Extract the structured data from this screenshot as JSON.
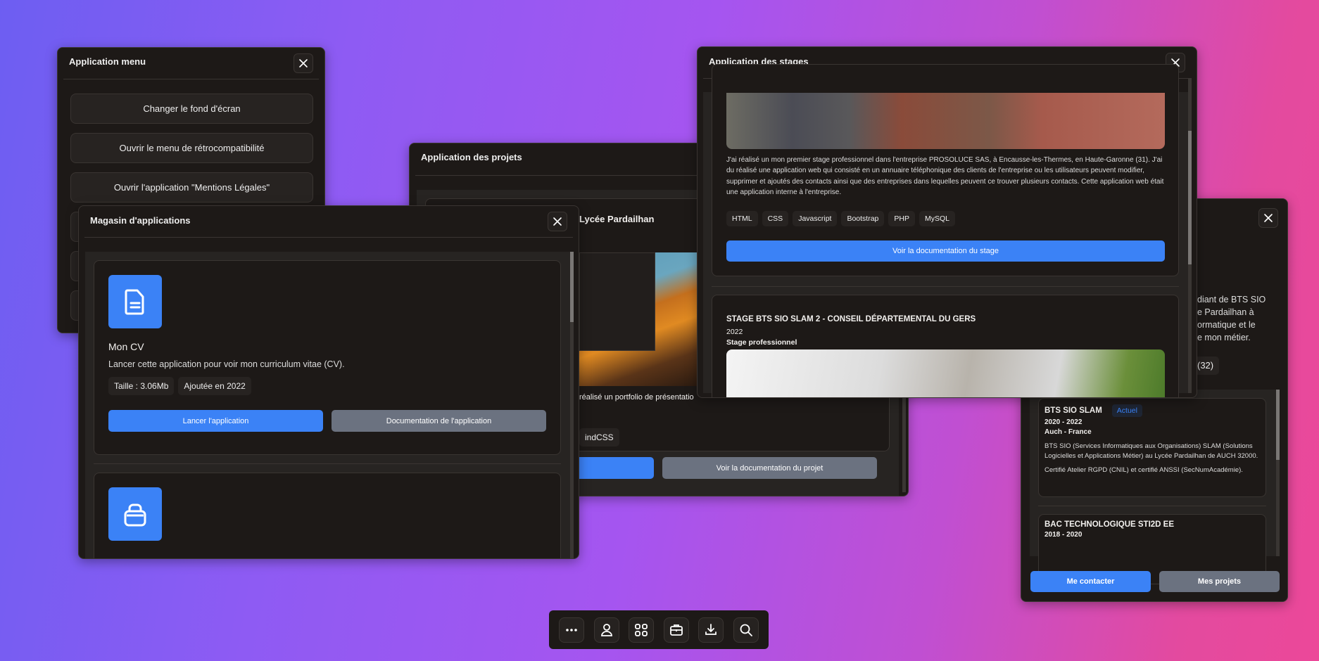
{
  "colors": {
    "accent": "#3b82f6",
    "secondary": "#6b7280",
    "window_bg": "#1d1917"
  },
  "menu_window": {
    "title": "Application menu",
    "items": [
      "Changer le fond d'écran",
      "Ouvrir le menu de rétrocompatibilité",
      "Ouvrir l'application \"Mentions Légales\""
    ]
  },
  "projects_window": {
    "title": "Application des projets",
    "heading_fragment": "Lycée Pardailhan",
    "desc_fragment": "réalisé un portfolio de présentatio",
    "tag_fragment": "indCSS",
    "doc_button": "Voir la documentation du projet"
  },
  "store_window": {
    "title": "Magasin d'applications",
    "apps": [
      {
        "icon": "document-icon",
        "name": "Mon CV",
        "description": "Lancer cette application pour voir mon curriculum vitae (CV).",
        "size": "Taille : 3.06Mb",
        "added": "Ajoutée en 2022",
        "launch": "Lancer l'application",
        "docs": "Documentation de l'application"
      },
      {
        "icon": "lock-icon"
      }
    ]
  },
  "stages_window": {
    "title": "Application des stages",
    "stage1": {
      "description": "J'ai réalisé un mon premier stage professionnel dans l'entreprise PROSOLUCE SAS, à Encausse-les-Thermes, en Haute-Garonne (31). J'ai du réalisé une application web qui consisté en un annuaire téléphonique des clients de l'entreprise ou les utilisateurs peuvent modifier, supprimer et ajoutés des contacts ainsi que des entreprises dans lequelles peuvent ce trouver plusieurs contacts. Cette application web était une application interne à l'entreprise.",
      "tags": [
        "HTML",
        "CSS",
        "Javascript",
        "Bootstrap",
        "PHP",
        "MySQL"
      ],
      "button": "Voir la documentation du stage"
    },
    "stage2": {
      "title": "STAGE BTS SIO SLAM 2 - CONSEIL DÉPARTEMENTAL DU GERS",
      "year": "2022",
      "type": "Stage professionnel"
    }
  },
  "cv_window": {
    "intro_fragments": [
      "diant de BTS SIO",
      "e Pardailhan à",
      "ormatique et le",
      "e mon métier."
    ],
    "badge_fragment": "(32)",
    "education": [
      {
        "title": "BTS SIO SLAM",
        "badge": "Actuel",
        "years": "2020 - 2022",
        "location": "Auch - France",
        "p1": "BTS SIO (Services Informatiques aux Organisations) SLAM (Solutions Logicielles et Applications Métier) au Lycée Pardailhan de AUCH 32000.",
        "p2": "Certifié Atelier RGPD (CNIL) et certifié ANSSI (SecNumAcadémie)."
      },
      {
        "title": "BAC TECHNOLOGIQUE STI2D EE",
        "years": "2018 - 2020"
      }
    ],
    "contact_button": "Me contacter",
    "projects_button": "Mes projets"
  },
  "taskbar": {
    "icons": [
      "more-icon",
      "user-icon",
      "apps-grid-icon",
      "briefcase-icon",
      "download-icon",
      "search-icon"
    ]
  }
}
